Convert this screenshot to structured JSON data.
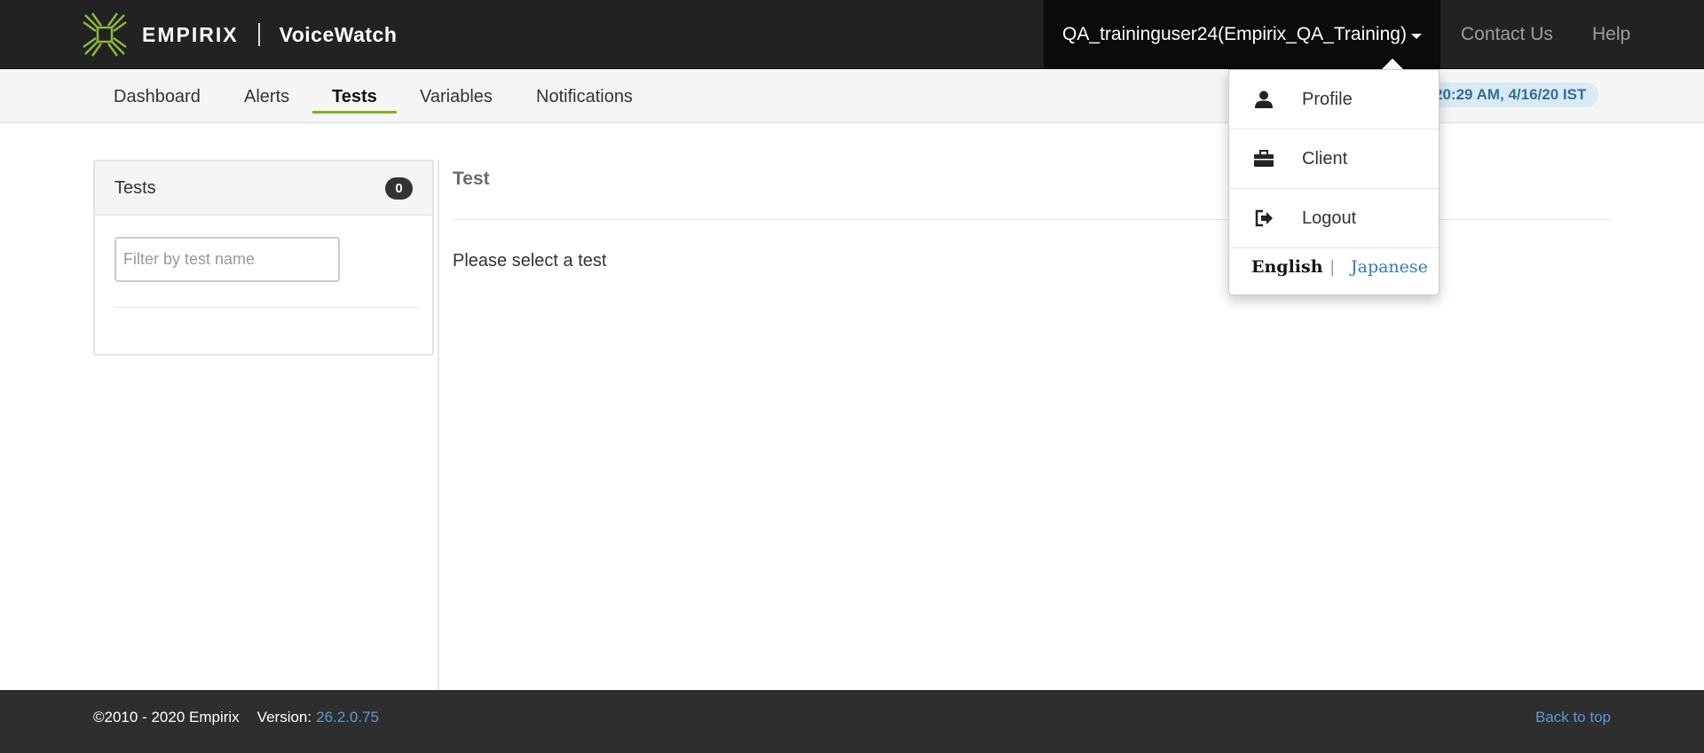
{
  "header": {
    "brand_name": "EMPIRIX",
    "product_name": "VoiceWatch",
    "user_menu_label": "QA_traininguser24(Empirix_QA_Training)",
    "contact_label": "Contact Us",
    "help_label": "Help"
  },
  "subnav": {
    "items": [
      {
        "label": "Dashboard",
        "active": false
      },
      {
        "label": "Alerts",
        "active": false
      },
      {
        "label": "Tests",
        "active": true
      },
      {
        "label": "Variables",
        "active": false
      },
      {
        "label": "Notifications",
        "active": false
      }
    ],
    "timestamp": "20:29 AM, 4/16/20 IST"
  },
  "tests_panel": {
    "title": "Tests",
    "count": "0",
    "filter_placeholder": "Filter by test name",
    "filter_value": ""
  },
  "main": {
    "title": "Test",
    "message": "Please select a test"
  },
  "user_dropdown": {
    "items": [
      {
        "label": "Profile",
        "icon": "user-icon"
      },
      {
        "label": "Client",
        "icon": "briefcase-icon"
      },
      {
        "label": "Logout",
        "icon": "logout-icon"
      }
    ],
    "languages": {
      "english": "English",
      "separator": "|",
      "japanese": "Japanese"
    }
  },
  "footer": {
    "copyright": "©2010 - 2020 Empirix",
    "version_label": "Version:",
    "version_value": "26.2.0.75",
    "back_to_top": "Back to top"
  },
  "colors": {
    "accent_green": "#7ab31e",
    "navbar_bg": "#222222",
    "link_blue": "#337ab7",
    "timestamp_bg": "#d9eaf5"
  }
}
